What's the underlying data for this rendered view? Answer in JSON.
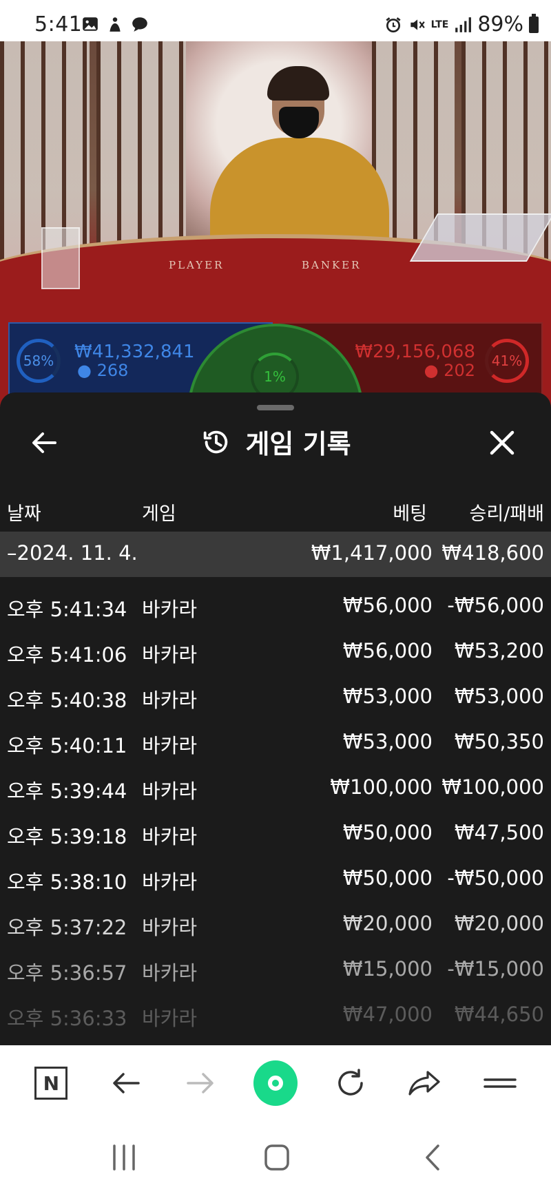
{
  "status_bar": {
    "time": "5:41",
    "battery": "89%",
    "network": "LTE"
  },
  "video": {
    "table_labels": {
      "player": "PLAYER",
      "banker": "BANKER"
    },
    "player": {
      "percent": "58%",
      "amount": "₩41,332,841",
      "count": "268",
      "color": "#3f86e6"
    },
    "tie": {
      "percent": "1%",
      "color": "#35c03d"
    },
    "banker": {
      "percent": "41%",
      "amount": "₩29,156,068",
      "count": "202",
      "color": "#d03030"
    }
  },
  "sheet": {
    "title": "게임 기록",
    "columns": {
      "date": "날짜",
      "game": "게임",
      "bet": "베팅",
      "result": "승리/패배"
    },
    "day": {
      "date": "–2024. 11. 4.",
      "bet": "₩1,417,000",
      "result": "₩418,600"
    },
    "rows": [
      {
        "time": "오후 5:41:34",
        "game": "바카라",
        "bet": "₩56,000",
        "result": "-₩56,000"
      },
      {
        "time": "오후 5:41:06",
        "game": "바카라",
        "bet": "₩56,000",
        "result": "₩53,200"
      },
      {
        "time": "오후 5:40:38",
        "game": "바카라",
        "bet": "₩53,000",
        "result": "₩53,000"
      },
      {
        "time": "오후 5:40:11",
        "game": "바카라",
        "bet": "₩53,000",
        "result": "₩50,350"
      },
      {
        "time": "오후 5:39:44",
        "game": "바카라",
        "bet": "₩100,000",
        "result": "₩100,000"
      },
      {
        "time": "오후 5:39:18",
        "game": "바카라",
        "bet": "₩50,000",
        "result": "₩47,500"
      },
      {
        "time": "오후 5:38:10",
        "game": "바카라",
        "bet": "₩50,000",
        "result": "-₩50,000"
      },
      {
        "time": "오후 5:37:22",
        "game": "바카라",
        "bet": "₩20,000",
        "result": "₩20,000"
      },
      {
        "time": "오후 5:36:57",
        "game": "바카라",
        "bet": "₩15,000",
        "result": "-₩15,000"
      },
      {
        "time": "오후 5:36:33",
        "game": "바카라",
        "bet": "₩47,000",
        "result": "₩44,650"
      }
    ]
  },
  "toolbar": {
    "items": [
      "naver-home-icon",
      "back-arrow-icon",
      "forward-arrow-icon",
      "green-dot-icon",
      "refresh-icon",
      "share-icon",
      "menu-icon"
    ],
    "accent": "#19d98a"
  },
  "navbar": {
    "items": [
      "recents-icon",
      "home-icon",
      "back-icon"
    ]
  }
}
